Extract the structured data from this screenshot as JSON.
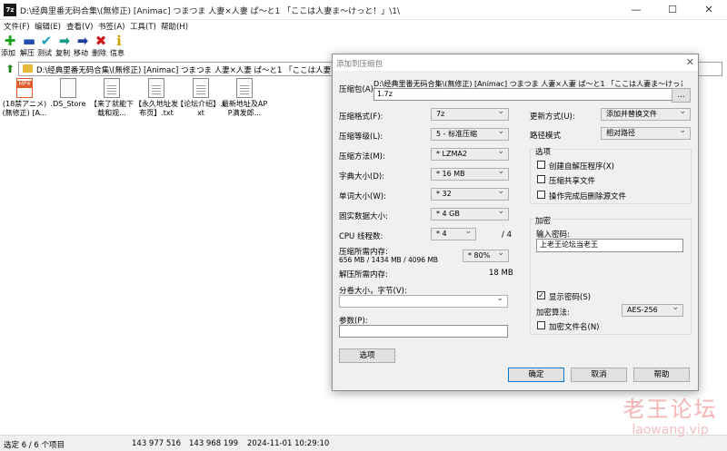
{
  "window": {
    "icon_text": "7z",
    "title": "D:\\经典里番无码合集\\(無修正) [Animac] つまつま 人妻×人妻 ぱ～と1 「ここは人妻ま〜けっと！」\\1\\",
    "minimize": "—",
    "maximize": "☐",
    "close": "✕"
  },
  "menu": [
    "文件(F)",
    "编辑(E)",
    "查看(V)",
    "书签(A)",
    "工具(T)",
    "帮助(H)"
  ],
  "toolbar": [
    {
      "label": "添加",
      "icon": "add-icon",
      "glyph": "✚",
      "color": "#1aa31a"
    },
    {
      "label": "解压",
      "icon": "extract-icon",
      "glyph": "▬",
      "color": "#1f4fb0"
    },
    {
      "label": "测试",
      "icon": "test-icon",
      "glyph": "✔",
      "color": "#1aa0b8"
    },
    {
      "label": "复制",
      "icon": "copy-icon",
      "glyph": "➡",
      "color": "#1a9b8a"
    },
    {
      "label": "移动",
      "icon": "move-icon",
      "glyph": "➡",
      "color": "#1f3fa0"
    },
    {
      "label": "删除",
      "icon": "delete-icon",
      "glyph": "✖",
      "color": "#d01919"
    },
    {
      "label": "信息",
      "icon": "info-icon",
      "glyph": "ℹ",
      "color": "#c9a000"
    }
  ],
  "address": {
    "path": "D:\\经典里番无码合集\\(無修正) [Animac] つまつま 人妻×人妻 ぱ～と1 「ここは人妻ま〜けっと！」\\1\\"
  },
  "files": [
    {
      "name": "(18禁アニメ) (無修正) [A...",
      "type": "mp4",
      "tag": "MP4"
    },
    {
      "name": ".DS_Store",
      "type": "file"
    },
    {
      "name": "【来了就能下载和观...",
      "type": "txt"
    },
    {
      "name": "【永久地址发布页】.txt",
      "type": "txt"
    },
    {
      "name": "【论坛介绍】.txt",
      "type": "txt"
    },
    {
      "name": "最新地址及APP满发郎...",
      "type": "txt"
    }
  ],
  "status": {
    "selection": "选定 6 / 6 个项目",
    "size": "143 977 516",
    "packed": "143 968 199",
    "date": "2024-11-01 10:29:10"
  },
  "watermark": {
    "main": "老王论坛",
    "sub": "laowang.vip"
  },
  "dialog": {
    "title": "添加到压缩包",
    "archive_label": "压缩包(A):",
    "archive_path": "D:\\经典里番无码合集\\(無修正) [Animac] つまつま 人妻×人妻 ぱ～と1 「ここは人妻ま〜けっと！」\\1\\",
    "archive_name": "1.7z",
    "browse": "...",
    "format_label": "压缩格式(F):",
    "format_value": "7z",
    "level_label": "压缩等级(L):",
    "level_value": "5 - 标准压缩",
    "method_label": "压缩方法(M):",
    "method_value": "* LZMA2",
    "dict_label": "字典大小(D):",
    "dict_value": "* 16 MB",
    "word_label": "单词大小(W):",
    "word_value": "* 32",
    "solid_label": "固实数据大小:",
    "solid_value": "* 4 GB",
    "cpu_label": "CPU 线程数:",
    "cpu_value": "* 4",
    "cpu_total": "/ 4",
    "mem_label": "压缩所需内存:",
    "mem_detail": "656 MB / 1434 MB / 4096 MB",
    "mem_value": "* 80%",
    "decomp_label": "解压所需内存:",
    "decomp_value": "18 MB",
    "split_label": "分卷大小，字节(V):",
    "split_value": "",
    "params_label": "参数(P):",
    "params_value": "",
    "options_button": "选项",
    "update_label": "更新方式(U):",
    "update_value": "添加并替换文件",
    "path_mode_label": "路径模式",
    "path_mode_value": "相对路径",
    "options_group": "选项",
    "opt_sfx": "创建自解压程序(X)",
    "opt_shared": "压缩共享文件",
    "opt_delete": "操作完成后删除源文件",
    "encrypt_group": "加密",
    "password_label": "输入密码:",
    "password_value": "上老王论坛当老王",
    "show_password": "显示密码(S)",
    "show_password_checked": true,
    "enc_method_label": "加密算法:",
    "enc_method_value": "AES-256",
    "encrypt_names": "加密文件名(N)",
    "ok": "确定",
    "cancel": "取消",
    "help": "帮助"
  }
}
